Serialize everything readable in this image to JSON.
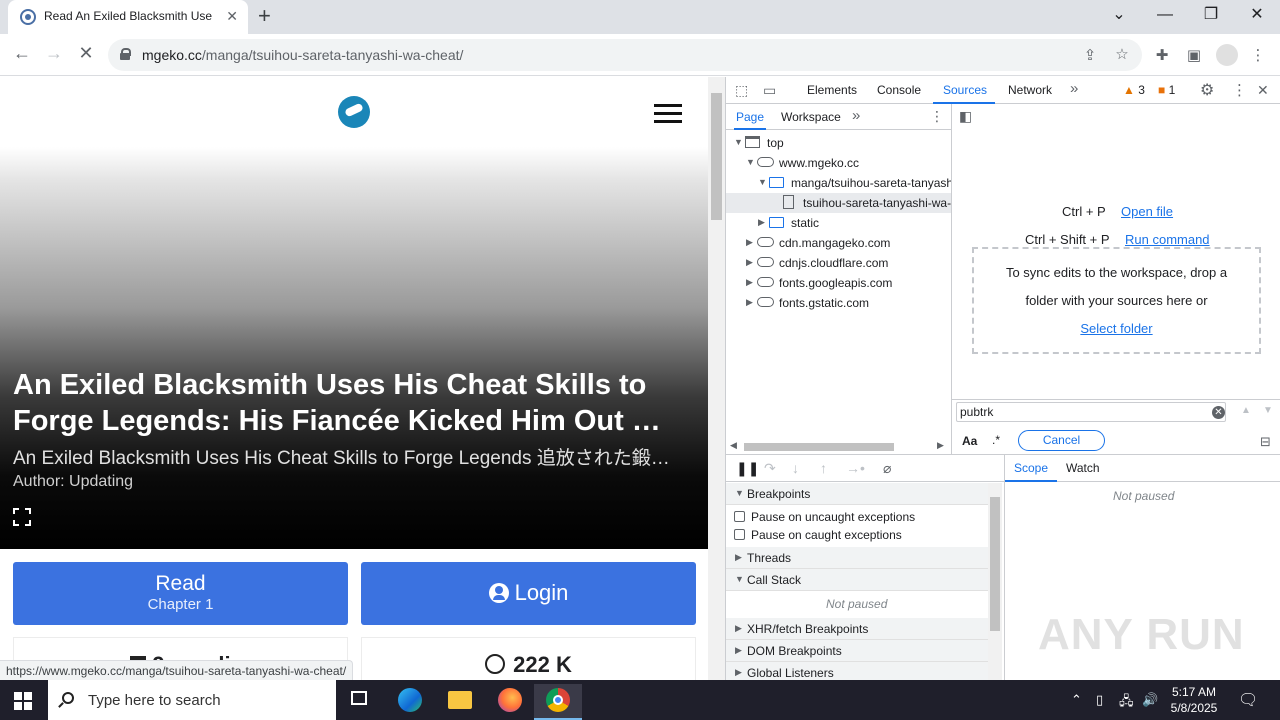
{
  "browser": {
    "tab_title": "Read An Exiled Blacksmith Uses His Cheat Skills to Forge Legends",
    "tab_close": "✕",
    "new_tab": "+",
    "window_controls": {
      "dropdown": "⌄",
      "minimize": "—",
      "restore": "❐",
      "close": "✕"
    },
    "nav": {
      "back": "←",
      "forward": "→",
      "stop": "✕"
    },
    "url_domain": "mgeko.cc",
    "url_path": "/manga/tsuihou-sareta-tanyashi-wa-cheat/",
    "status_url": "https://www.mgeko.cc/manga/tsuihou-sareta-tanyashi-wa-cheat/"
  },
  "page": {
    "title_line1": "An Exiled Blacksmith Uses His Cheat Skills to",
    "title_line2": "Forge Legends: His Fiancée Kicked Him Out …",
    "alt_title": "An Exiled Blacksmith Uses His Cheat Skills to Forge Legends 追放された鍛…",
    "author": "Author: Updating",
    "read_label": "Read",
    "read_sub": "Chapter 1",
    "login_label": "Login",
    "stat_author": "9-eng-li",
    "stat_views": "222 K"
  },
  "devtools": {
    "tabs": [
      "Elements",
      "Console",
      "Sources",
      "Network"
    ],
    "more": "»",
    "warnings": "3",
    "issues": "1",
    "nav_tabs": [
      "Page",
      "Workspace"
    ],
    "tree": [
      {
        "label": "top",
        "type": "frame"
      },
      {
        "label": "www.mgeko.cc",
        "type": "cloud"
      },
      {
        "label": "manga/tsuihou-sareta-tanyash",
        "type": "folder"
      },
      {
        "label": "tsuihou-sareta-tanyashi-wa-",
        "type": "file"
      },
      {
        "label": "static",
        "type": "folder"
      },
      {
        "label": "cdn.mangageko.com",
        "type": "cloud"
      },
      {
        "label": "cdnjs.cloudflare.com",
        "type": "cloud"
      },
      {
        "label": "fonts.googleapis.com",
        "type": "cloud"
      },
      {
        "label": "fonts.gstatic.com",
        "type": "cloud"
      }
    ],
    "shortcut_open_keys": "Ctrl + P",
    "shortcut_open_label": "Open file",
    "shortcut_run_keys": "Ctrl + Shift + P",
    "shortcut_run_label": "Run command",
    "drop_text_1": "To sync edits to the workspace, drop a",
    "drop_text_2": "folder with your sources here or",
    "select_folder": "Select folder",
    "search_value": "pubtrk",
    "match_case": "Aa",
    "regex": ".*",
    "cancel": "Cancel",
    "breakpoints": "Breakpoints",
    "pause_uncaught": "Pause on uncaught exceptions",
    "pause_caught": "Pause on caught exceptions",
    "threads": "Threads",
    "call_stack": "Call Stack",
    "not_paused": "Not paused",
    "xhr_breakpoints": "XHR/fetch Breakpoints",
    "dom_breakpoints": "DOM Breakpoints",
    "global_listeners": "Global Listeners",
    "scope": "Scope",
    "watch": "Watch"
  },
  "taskbar": {
    "search_placeholder": "Type here to search",
    "time": "5:17 AM",
    "date": "5/8/2025"
  },
  "watermark": "ANY RUN"
}
